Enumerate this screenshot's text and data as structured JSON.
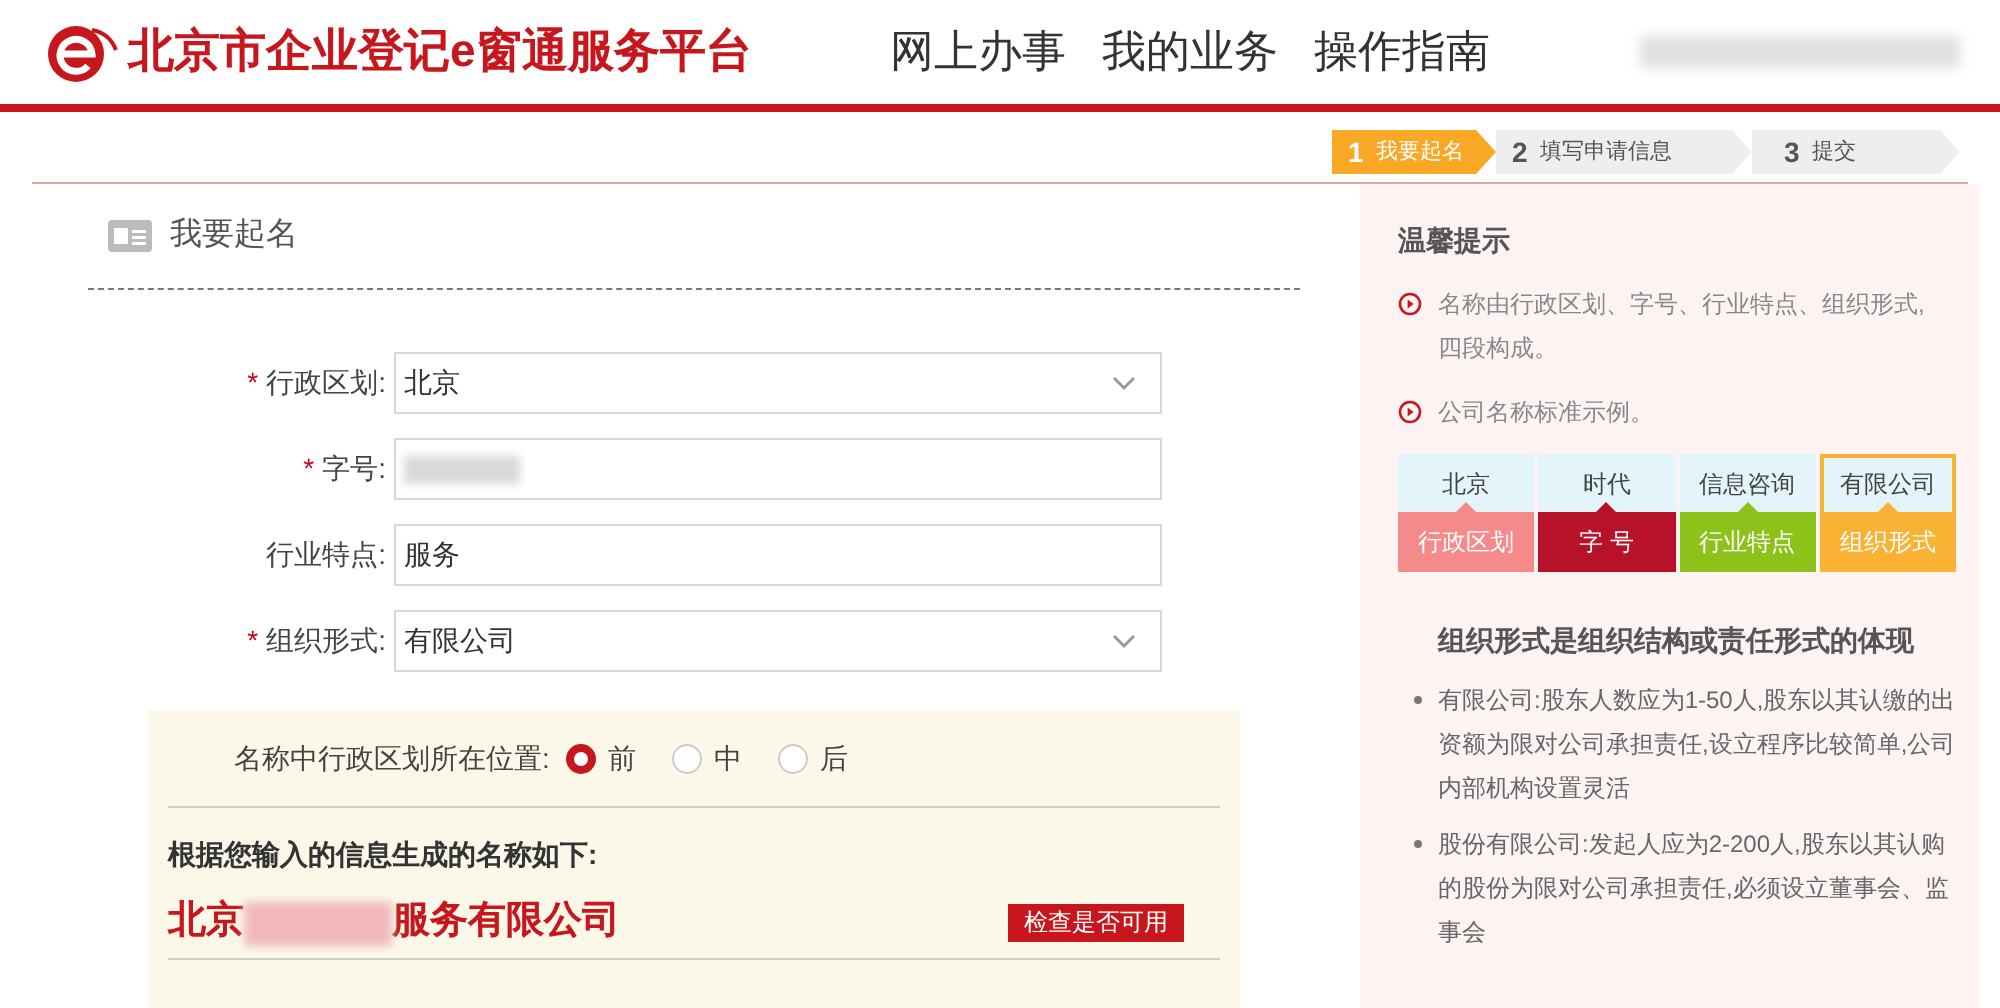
{
  "header": {
    "site_title": "北京市企业登记e窗通服务平台",
    "nav": [
      {
        "label": "网上办事"
      },
      {
        "label": "我的业务"
      },
      {
        "label": "操作指南"
      }
    ]
  },
  "steps": [
    {
      "number": "1",
      "label": "我要起名",
      "selected": true
    },
    {
      "number": "2",
      "label": "填写申请信息",
      "selected": false
    },
    {
      "number": "3",
      "label": "提交",
      "selected": false
    }
  ],
  "form": {
    "title": "我要起名",
    "fields": [
      {
        "required_mark": "*",
        "label": "行政区划:",
        "kind": "select",
        "value": "北京"
      },
      {
        "required_mark": "*",
        "label": "字号:",
        "kind": "blurred"
      },
      {
        "label": "行业特点:",
        "kind": "text",
        "value": "服务"
      },
      {
        "required_mark": "*",
        "label": "组织形式:",
        "kind": "select",
        "value": "有限公司"
      }
    ],
    "position": {
      "label": "名称中行政区划所在位置:",
      "options": [
        {
          "label": "前",
          "selected": true
        },
        {
          "label": "中",
          "selected": false
        },
        {
          "label": "后",
          "selected": false
        }
      ]
    },
    "result_label": "根据您输入的信息生成的名称如下:",
    "generated_name": {
      "prefix": "北京",
      "suffix": "服务有限公司"
    },
    "check_button": "检查是否可用"
  },
  "tips": {
    "title": "温馨提示",
    "items": [
      "名称由行政区划、字号、行业特点、组织形式,四段构成。",
      "公司名称标准示例。"
    ],
    "example": [
      {
        "value": "北京",
        "part": "行政区划",
        "color": "#f58a8a",
        "selected": false
      },
      {
        "value": "时代",
        "part": "字 号",
        "color": "#b8122a",
        "selected": false
      },
      {
        "value": "信息咨询",
        "part": "行业特点",
        "color": "#8cc21a",
        "selected": false
      },
      {
        "value": "有限公司",
        "part": "组织形式",
        "color": "#f9b233",
        "selected": true
      }
    ],
    "subtitle": "组织形式是组织结构或责任形式的体现",
    "bullets": [
      "有限公司:股东人数应为1-50人,股东以其认缴的出资额为限对公司承担责任,设立程序比较简单,公司内部机构设置灵活",
      "股份有限公司:发起人应为2-200人,股东以其认购的股份为限对公司承担责任,必须设立董事会、监事会"
    ]
  }
}
